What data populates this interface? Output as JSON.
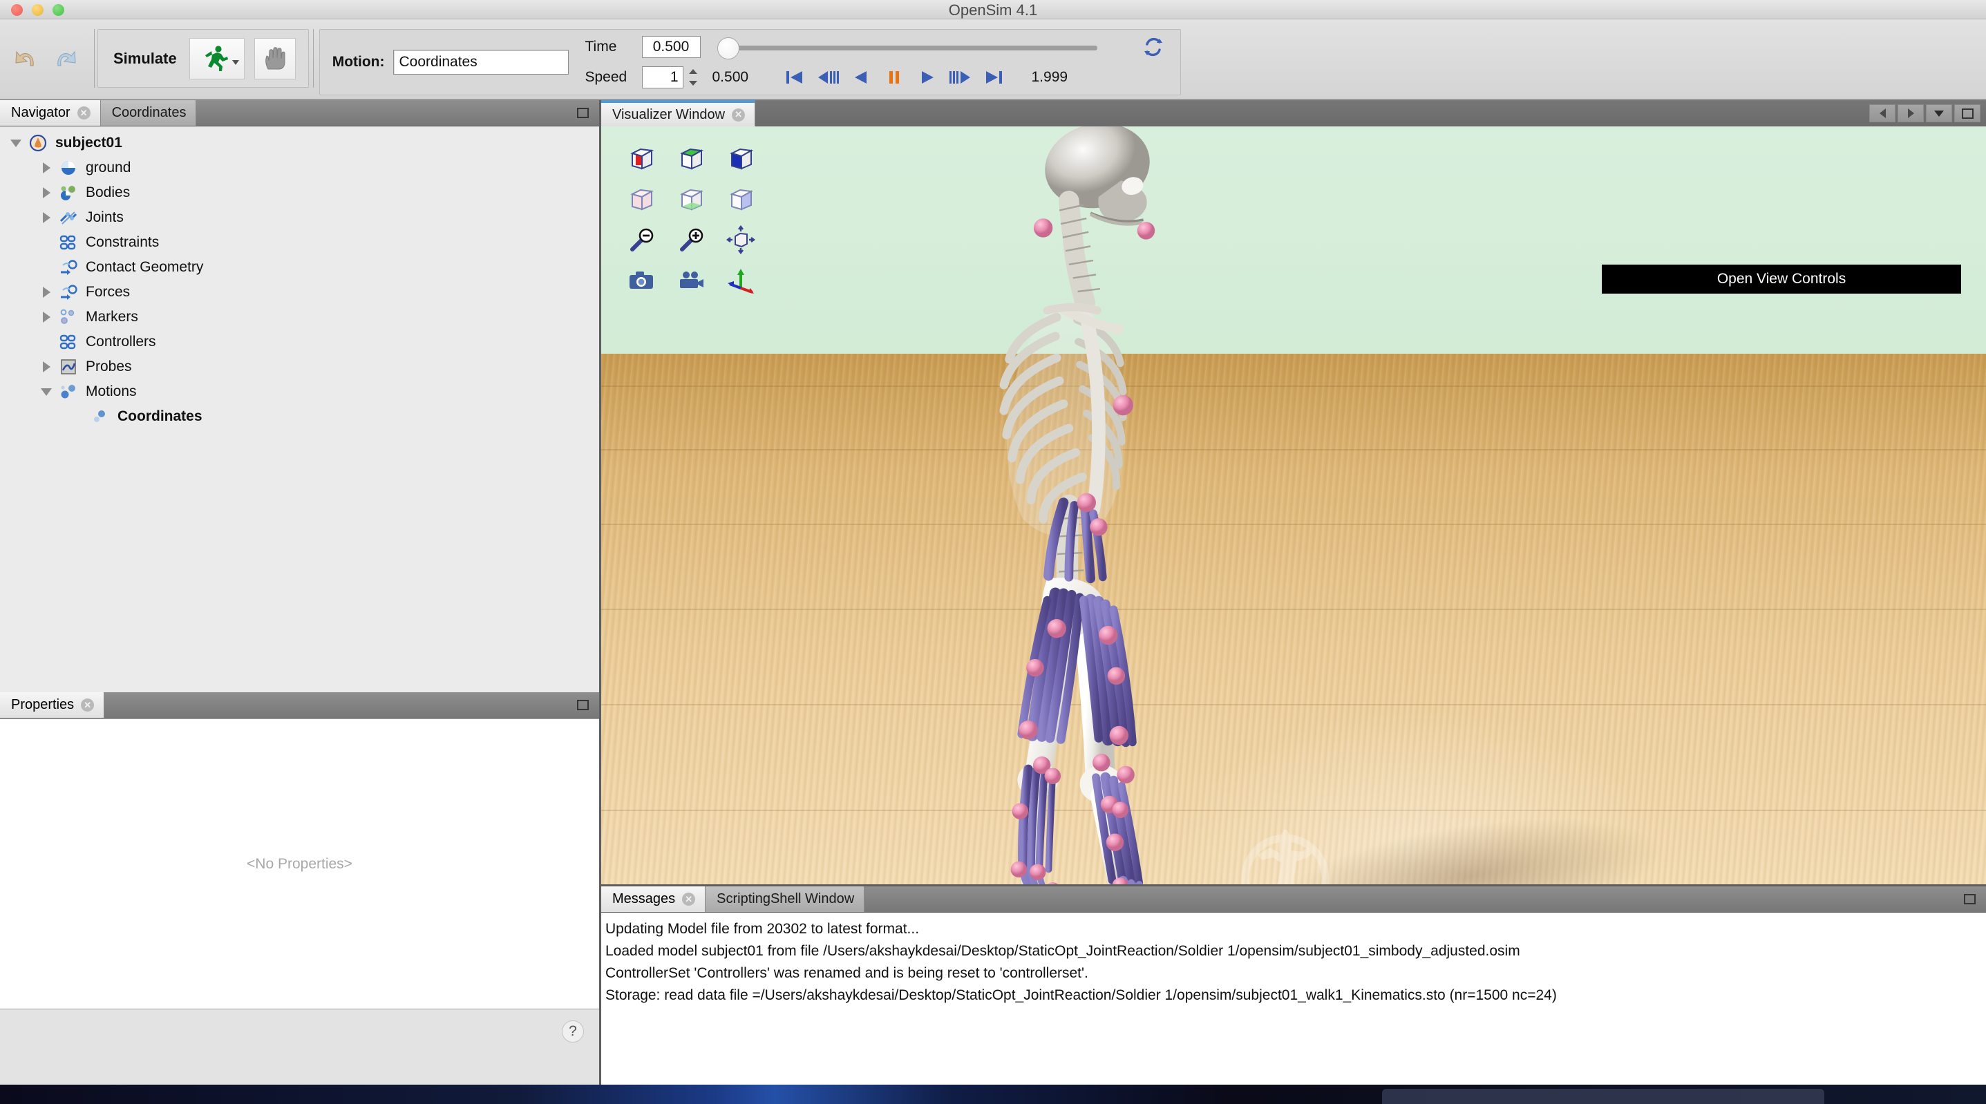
{
  "window": {
    "title": "OpenSim 4.1",
    "traffic_lights": [
      "close",
      "minimize",
      "maximize"
    ]
  },
  "toolbar": {
    "undo_label": "Undo",
    "redo_label": "Redo",
    "simulate_label": "Simulate",
    "run_tooltip": "Run Simulation",
    "stop_tooltip": "Stop",
    "motion_label": "Motion:",
    "motion_value": "Coordinates",
    "time_label": "Time",
    "time_value": "0.500",
    "speed_label": "Speed",
    "speed_value": "1",
    "current_time": "0.500",
    "end_time": "1.999",
    "loop_tooltip": "Loop",
    "transport": [
      {
        "name": "skip-to-start",
        "glyph": "|<"
      },
      {
        "name": "step-back-fast",
        "glyph": "<||"
      },
      {
        "name": "play-backward",
        "glyph": "<"
      },
      {
        "name": "pause",
        "glyph": "||"
      },
      {
        "name": "play-forward",
        "glyph": ">"
      },
      {
        "name": "step-forward-fast",
        "glyph": "||>"
      },
      {
        "name": "skip-to-end",
        "glyph": ">|"
      }
    ]
  },
  "navigator": {
    "tabs": [
      {
        "label": "Navigator",
        "active": true,
        "closable": true
      },
      {
        "label": "Coordinates",
        "active": false,
        "closable": false
      }
    ],
    "tree": [
      {
        "label": "subject01",
        "depth": 0,
        "twisty": "down",
        "icon": "opensim-model-icon",
        "bold": true
      },
      {
        "label": "ground",
        "depth": 1,
        "twisty": "right",
        "icon": "ground-icon",
        "bold": false
      },
      {
        "label": "Bodies",
        "depth": 1,
        "twisty": "right",
        "icon": "bodies-icon",
        "bold": false
      },
      {
        "label": "Joints",
        "depth": 1,
        "twisty": "right",
        "icon": "joints-icon",
        "bold": false
      },
      {
        "label": "Constraints",
        "depth": 1,
        "twisty": "none",
        "icon": "constraints-icon",
        "bold": false
      },
      {
        "label": "Contact Geometry",
        "depth": 1,
        "twisty": "none",
        "icon": "contact-geometry-icon",
        "bold": false
      },
      {
        "label": "Forces",
        "depth": 1,
        "twisty": "right",
        "icon": "forces-icon",
        "bold": false
      },
      {
        "label": "Markers",
        "depth": 1,
        "twisty": "right",
        "icon": "markers-icon",
        "bold": false
      },
      {
        "label": "Controllers",
        "depth": 1,
        "twisty": "none",
        "icon": "controllers-icon",
        "bold": false
      },
      {
        "label": "Probes",
        "depth": 1,
        "twisty": "right",
        "icon": "probes-icon",
        "bold": false
      },
      {
        "label": "Motions",
        "depth": 1,
        "twisty": "down",
        "icon": "motions-icon",
        "bold": false
      },
      {
        "label": "Coordinates",
        "depth": 2,
        "twisty": "none",
        "icon": "motion-item-icon",
        "bold": true
      }
    ]
  },
  "properties": {
    "tab_label": "Properties",
    "empty_text": "<No Properties>",
    "help_label": "?"
  },
  "visualizer": {
    "tab_label": "Visualizer Window",
    "open_view_controls_label": "Open View Controls",
    "toolbar_buttons": [
      {
        "name": "view-front-icon",
        "row": 1,
        "col": 1
      },
      {
        "name": "view-top-icon",
        "row": 1,
        "col": 2
      },
      {
        "name": "view-side-icon",
        "row": 1,
        "col": 3
      },
      {
        "name": "view-back-icon",
        "row": 2,
        "col": 1
      },
      {
        "name": "view-bottom-icon",
        "row": 2,
        "col": 2
      },
      {
        "name": "view-other-side-icon",
        "row": 2,
        "col": 3
      },
      {
        "name": "zoom-out-icon",
        "row": 3,
        "col": 1
      },
      {
        "name": "zoom-in-icon",
        "row": 3,
        "col": 2
      },
      {
        "name": "fit-to-window-icon",
        "row": 3,
        "col": 3
      },
      {
        "name": "take-snapshot-icon",
        "row": 4,
        "col": 1
      },
      {
        "name": "record-movie-icon",
        "row": 4,
        "col": 2
      },
      {
        "name": "toggle-axes-icon",
        "row": 4,
        "col": 3
      }
    ],
    "scene": {
      "model_name": "subject01",
      "sky_color": "#d4ecd8",
      "floor_color": "#e0b87f",
      "bone_color": "#eeeeea",
      "muscle_color": "#6a5fa8",
      "marker_color": "#e88bb0",
      "watermark": "opensim-logo-watermark"
    },
    "nav_buttons": [
      {
        "name": "previous-window-button"
      },
      {
        "name": "next-window-button"
      },
      {
        "name": "window-list-button"
      },
      {
        "name": "maximize-window-button"
      }
    ]
  },
  "messages": {
    "tabs": [
      {
        "label": "Messages",
        "active": true,
        "closable": true
      },
      {
        "label": "ScriptingShell Window",
        "active": false,
        "closable": false
      }
    ],
    "lines": [
      "Updating Model file from 20302 to latest format...",
      "Loaded model subject01 from file /Users/akshaykdesai/Desktop/StaticOpt_JointReaction/Soldier 1/opensim/subject01_simbody_adjusted.osim",
      "ControllerSet 'Controllers' was renamed and is being reset to 'controllerset'.",
      "Storage: read data file =/Users/akshaykdesai/Desktop/StaticOpt_JointReaction/Soldier 1/opensim/subject01_walk1_Kinematics.sto (nr=1500 nc=24)"
    ]
  },
  "colors": {
    "accent_blue": "#4b9cd8",
    "panel_bg": "#ebebeb",
    "chrome_gray": "#6b6b6b",
    "sky_green": "#d4ecd8",
    "floor_tan": "#e0b87f",
    "muscle_purple": "#6a5fa8",
    "marker_pink": "#e88bb0",
    "pause_orange": "#e8730f",
    "transport_blue": "#3a5fb5"
  }
}
